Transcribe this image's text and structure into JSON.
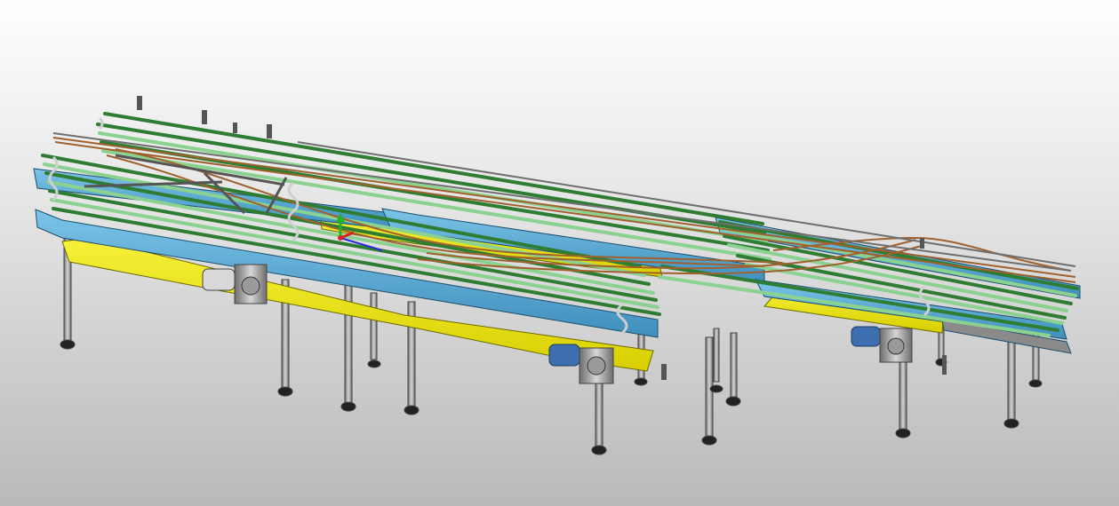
{
  "scene": {
    "colors": {
      "background_top": "#ffffff",
      "background_bottom": "#b9b9b9",
      "frame_blue": "#5aaed8",
      "frame_dark": "#2f6f96",
      "platform_yellow": "#f2ea12",
      "belt_green": "#2e7d32",
      "belt_light": "#8bd18f",
      "guide_rail_copper": "#a0612e",
      "leg_steel": "#9a9a9a",
      "motor_blue": "#3d6fb0",
      "gearbox_gray": "#bdbdbd"
    },
    "components": {
      "conveyor_sections": 3,
      "drive_motors": 3,
      "support_legs_visible": 14
    },
    "icons": {
      "triad": "axis-triad-icon"
    }
  }
}
